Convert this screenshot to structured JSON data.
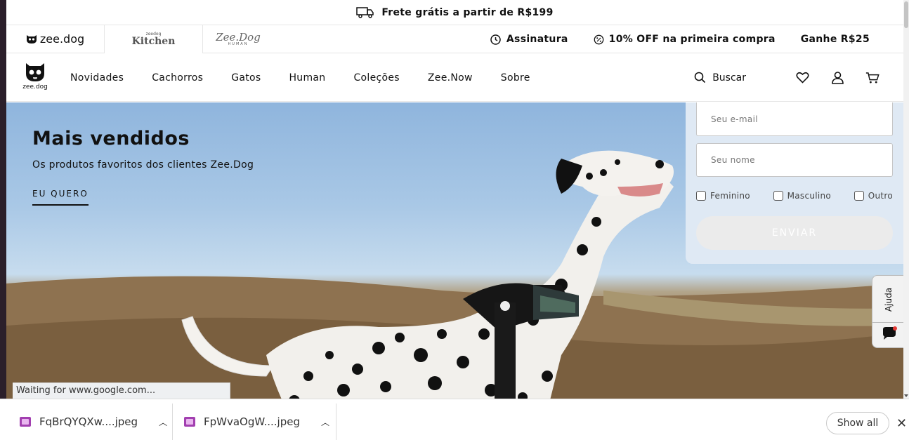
{
  "promo": {
    "text": "Frete grátis a partir de R$199",
    "icon": "truck-icon"
  },
  "brands": {
    "zeedog": "zee.dog",
    "kitchen_small": "zeedog",
    "kitchen": "Kitchen",
    "human": "Zee.Dog",
    "human_small": "HUMAN"
  },
  "toplinks": {
    "subscription": "Assinatura",
    "discount": "10% OFF na primeira compra",
    "earn": "Ganhe R$25"
  },
  "nav": {
    "logo_label": "zee.dog",
    "items": [
      "Novidades",
      "Cachorros",
      "Gatos",
      "Human",
      "Coleções",
      "Zee.Now",
      "Sobre"
    ],
    "search": "Buscar"
  },
  "hero": {
    "title": "Mais vendidos",
    "subtitle": "Os produtos favoritos dos clientes Zee.Dog",
    "cta": "EU QUERO"
  },
  "form": {
    "email_placeholder": "Seu e-mail",
    "name_placeholder": "Seu nome",
    "options": [
      "Feminino",
      "Masculino",
      "Outro"
    ],
    "submit": "ENVIAR"
  },
  "help": {
    "label": "Ajuda"
  },
  "browser": {
    "status": "Waiting for www.google.com...",
    "downloads": [
      "FqBrQYQXw....jpeg",
      "FpWvaOgW....jpeg"
    ],
    "show_all": "Show all",
    "close": "✕"
  },
  "colors": {
    "accent": "#111111",
    "form_bg": "#dfe9f4",
    "notify_dot": "#e53935"
  }
}
